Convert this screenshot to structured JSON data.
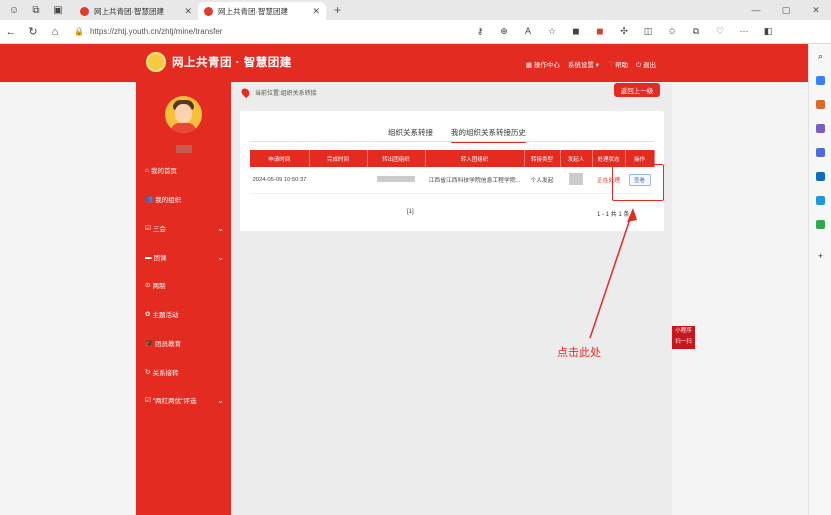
{
  "browser": {
    "tabs": [
      {
        "title": "网上共青团·智慧团建",
        "active": false
      },
      {
        "title": "网上共青团·智慧团建",
        "active": true
      }
    ],
    "url": "https://zhtj.youth.cn/zhtj/mine/transfer"
  },
  "header": {
    "logo_text": "网上共青团 · 智慧团建",
    "menu": [
      "操作中心",
      "系统设置",
      "帮助",
      "退出"
    ]
  },
  "sidebar": {
    "items": [
      {
        "label": "我的首页",
        "icon": "home-icon",
        "expandable": false
      },
      {
        "label": "我的组织",
        "icon": "people-icon",
        "expandable": false
      },
      {
        "label": "三会",
        "icon": "checkbox-icon",
        "expandable": true
      },
      {
        "label": "团课",
        "icon": "folder-icon",
        "expandable": true
      },
      {
        "label": "两制",
        "icon": "circle-icon",
        "expandable": false
      },
      {
        "label": "主题活动",
        "icon": "gear-icon",
        "expandable": false
      },
      {
        "label": "团员教育",
        "icon": "graduation-cap-icon",
        "expandable": false
      },
      {
        "label": "关系接转",
        "icon": "refresh-icon",
        "expandable": false
      },
      {
        "label": "\"两红两优\"评选",
        "icon": "checkbox-icon",
        "expandable": true
      }
    ]
  },
  "breadcrumb": {
    "text": "当前位置:组织关系转接"
  },
  "back_button": {
    "label": "返回上一级"
  },
  "tabs": [
    {
      "label": "组织关系转接",
      "active": false
    },
    {
      "label": "我的组织关系转接历史",
      "active": true
    }
  ],
  "table": {
    "columns": [
      "申请时间",
      "完成时间",
      "转出团组织",
      "转入团组织",
      "转接类型",
      "发起人",
      "处理状态",
      "操作"
    ],
    "rows": [
      {
        "apply_time": "2024-05-09 10:50:37",
        "done_time": "",
        "from_org": "",
        "to_org": "江西省江西科技学院信息工程学院...",
        "type": "个人发起",
        "initiator": "",
        "status": "正在处理",
        "action": "查看"
      }
    ]
  },
  "pagination": {
    "pages": "[1]",
    "total": "1 - 1 共 1 条"
  },
  "qr_tag": {
    "line1": "小程序",
    "line2": "扫一扫"
  },
  "annotation": {
    "text": "点击此处"
  },
  "colors": {
    "brand_red": "#e32b22",
    "link_blue": "#4a6fc7"
  }
}
